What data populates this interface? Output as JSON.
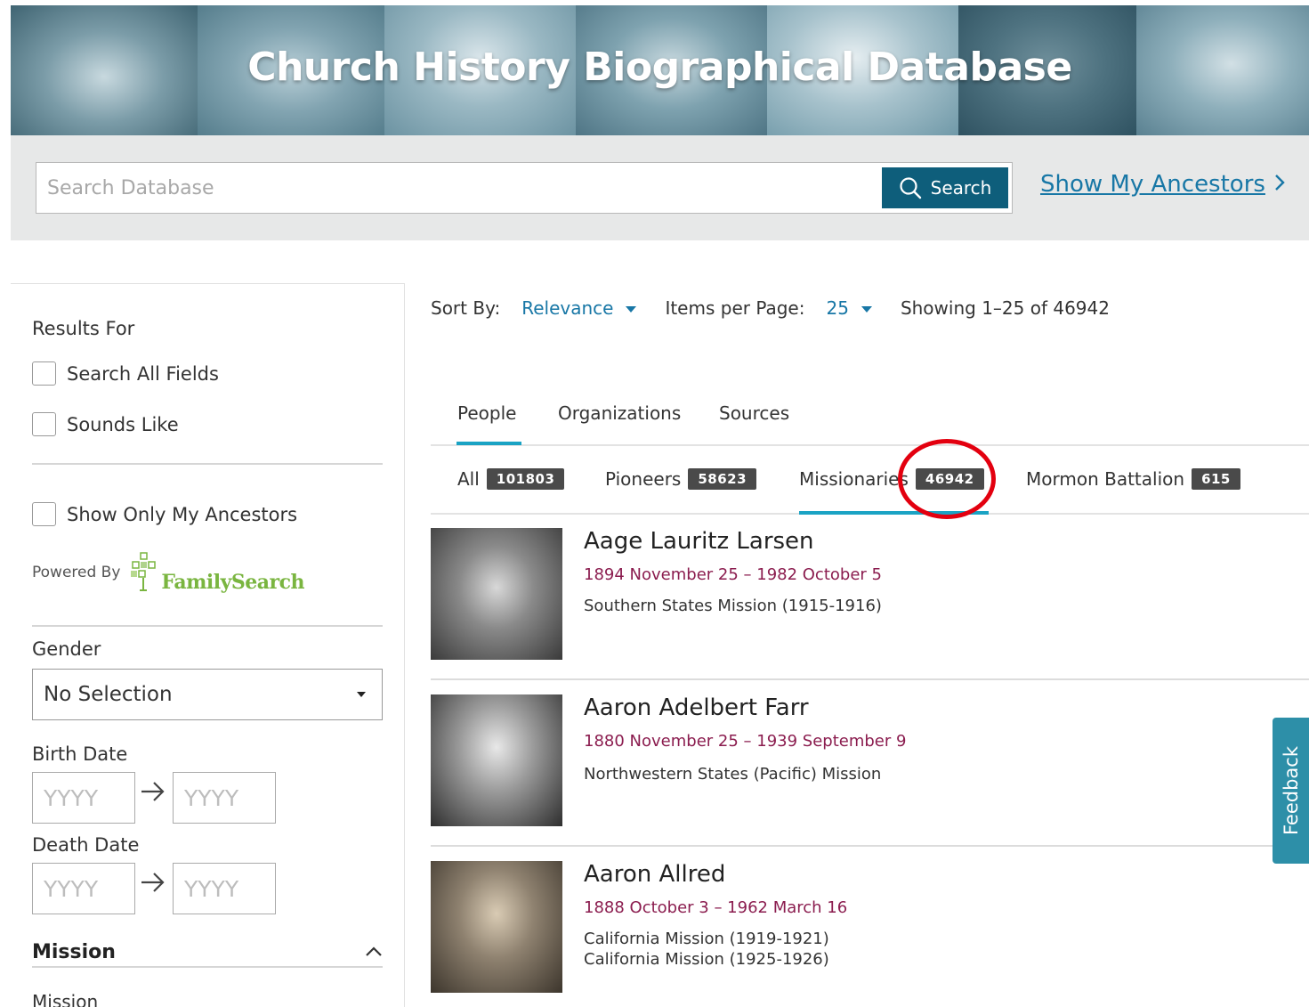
{
  "banner": {
    "title": "Church History Biographical Database"
  },
  "search": {
    "placeholder": "Search Database",
    "button_label": "Search",
    "ancestors_link": "Show My Ancestors"
  },
  "sidebar": {
    "results_for": "Results For",
    "search_all_fields": "Search All Fields",
    "sounds_like": "Sounds Like",
    "show_only_ancestors": "Show Only My Ancestors",
    "powered_by": "Powered By",
    "familysearch_logo_text": "FamilySearch",
    "gender_label": "Gender",
    "gender_value": "No Selection",
    "birth_date_label": "Birth Date",
    "death_date_label": "Death Date",
    "date_placeholder": "YYYY",
    "mission_heading": "Mission",
    "mission_sub": "Mission"
  },
  "sort": {
    "sort_by_label": "Sort By:",
    "sort_by_value": "Relevance",
    "items_label": "Items per Page:",
    "items_value": "25",
    "showing": "Showing 1–25 of 46942"
  },
  "tabs": [
    {
      "label": "People",
      "active": true
    },
    {
      "label": "Organizations",
      "active": false
    },
    {
      "label": "Sources",
      "active": false
    }
  ],
  "subtabs": [
    {
      "label": "All",
      "count": "101803"
    },
    {
      "label": "Pioneers",
      "count": "58623"
    },
    {
      "label": "Missionaries",
      "count": "46942",
      "active": true
    },
    {
      "label": "Mormon Battalion",
      "count": "615"
    }
  ],
  "results": [
    {
      "name": "Aage Lauritz Larsen",
      "dates": "1894 November 25 – 1982 October 5",
      "missions": [
        "Southern States Mission (1915-1916)"
      ]
    },
    {
      "name": "Aaron Adelbert Farr",
      "dates": "1880 November 25 – 1939 September 9",
      "missions": [
        "Northwestern States (Pacific) Mission"
      ]
    },
    {
      "name": "Aaron Allred",
      "dates": "1888 October 3 – 1962 March 16",
      "missions": [
        "California Mission (1919-1921)",
        "California Mission (1925-1926)"
      ]
    }
  ],
  "feedback_label": "Feedback",
  "colors": {
    "brand_teal": "#0e5e7b",
    "link_blue": "#1877a6",
    "tab_accent": "#1aa3c4",
    "date_maroon": "#8b1d4f",
    "badge_gray": "#4a4a4a",
    "highlight_red": "#e3000f",
    "familysearch_green": "#7ab540"
  }
}
